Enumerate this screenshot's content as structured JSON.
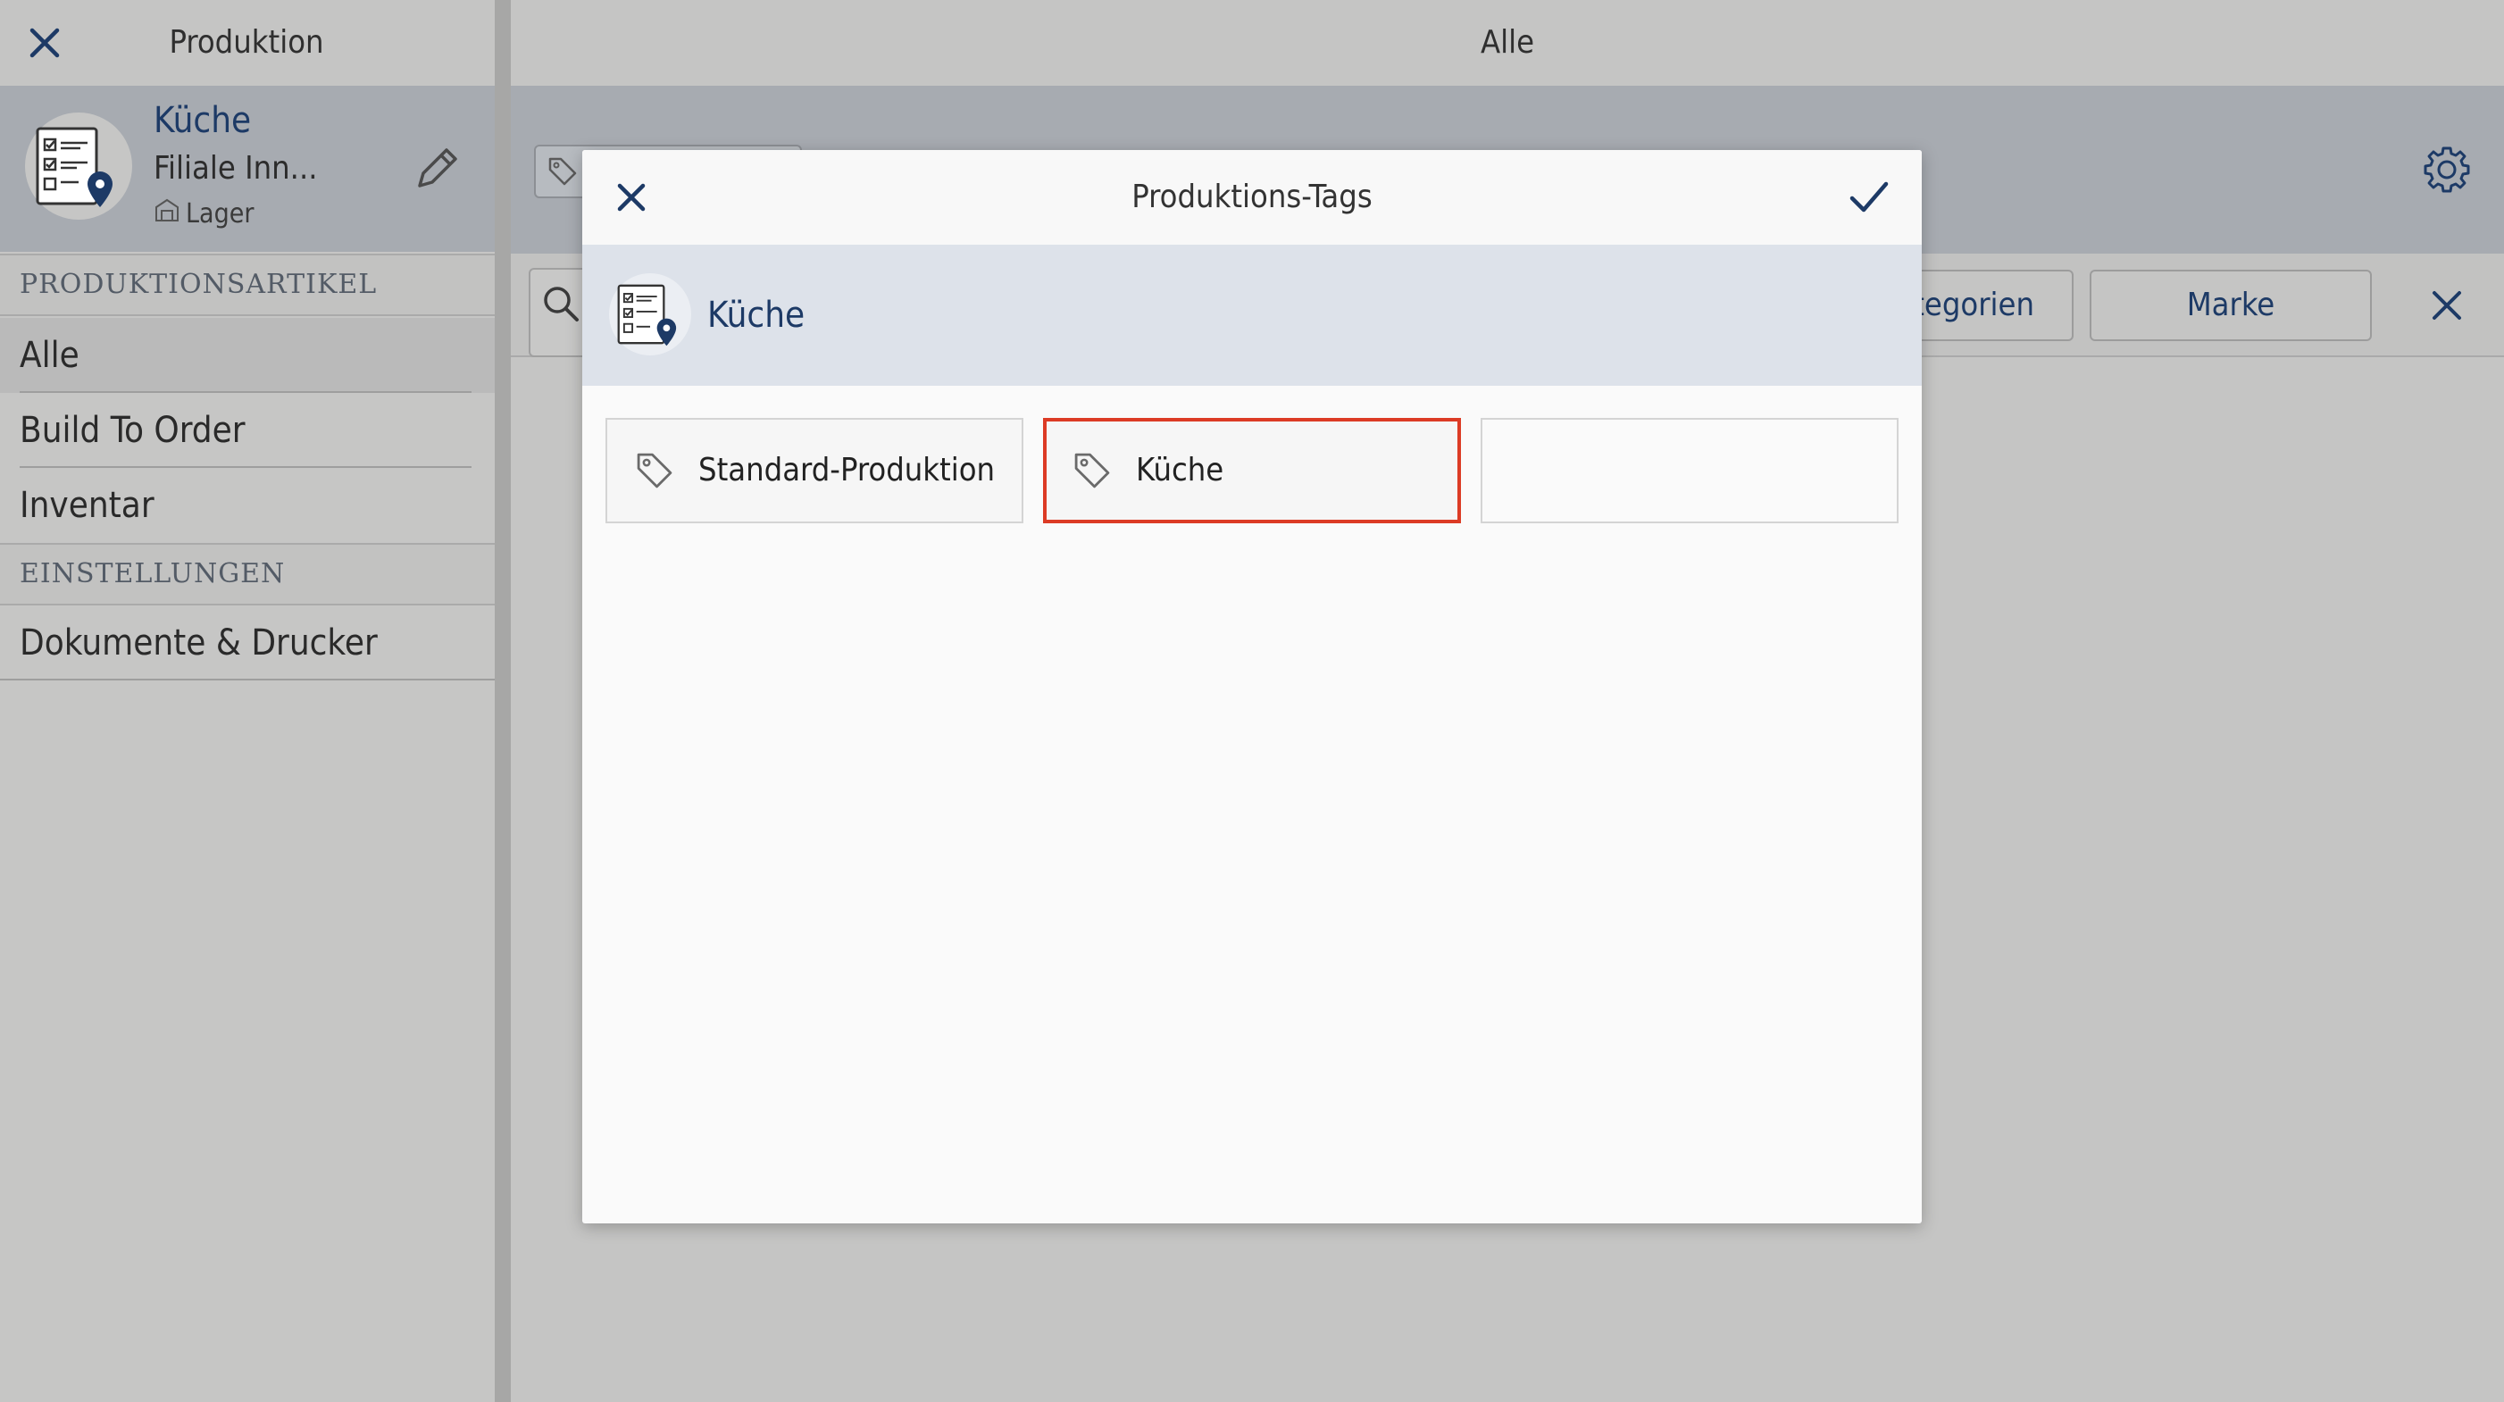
{
  "sidebar": {
    "title": "Produktion",
    "header": {
      "name": "Küche",
      "subtitle": "Filiale Inn...",
      "location": "Lager"
    },
    "sections": [
      {
        "label": "PRODUKTIONSARTIKEL"
      },
      {
        "label": "EINSTELLUNGEN"
      }
    ],
    "items": [
      {
        "label": "Alle",
        "active": true
      },
      {
        "label": "Build To Order"
      },
      {
        "label": "Inventar"
      },
      {
        "label": "Dokumente & Drucker"
      }
    ]
  },
  "main": {
    "title": "Alle",
    "filters": {
      "kategorien_label": "Kategorien",
      "marke_label": "Marke"
    }
  },
  "modal": {
    "title": "Produktions-Tags",
    "subtitle": "Küche",
    "tags": [
      {
        "label": "Standard-Produktion",
        "selected": false
      },
      {
        "label": "Küche",
        "selected": true
      },
      {
        "label": "",
        "selected": false
      }
    ]
  },
  "colors": {
    "accent": "#1d3a66",
    "selection": "#dc3b25",
    "overlay": "#c5c5c4",
    "header_band": "#a7abb1"
  },
  "icons": [
    "close-icon",
    "edit-icon",
    "gear-icon",
    "search-icon",
    "tag-icon",
    "check-icon",
    "location-checklist-icon",
    "warehouse-icon"
  ]
}
